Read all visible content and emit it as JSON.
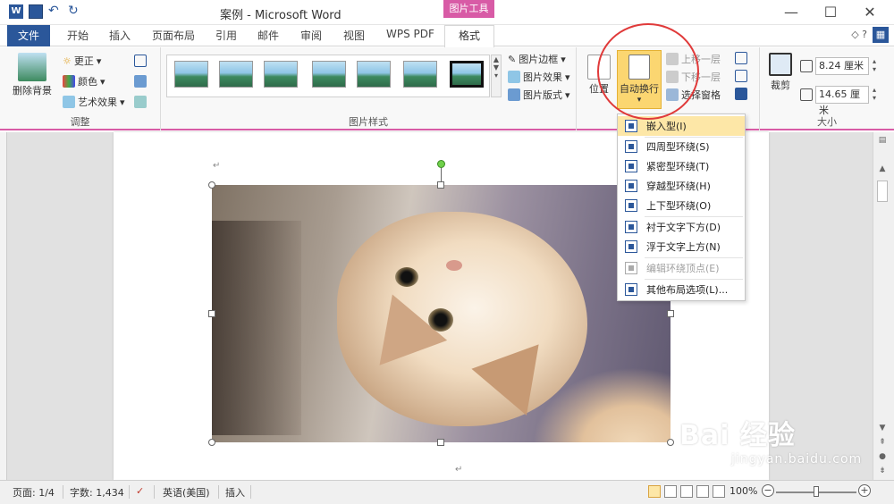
{
  "titlebar": {
    "title": "案例 - Microsoft Word",
    "tool_tab_header": "图片工具",
    "word_icon_letter": "W",
    "minimize": "—",
    "maximize": "☐",
    "close": "✕"
  },
  "tabs": {
    "file": "文件",
    "items": [
      "开始",
      "插入",
      "页面布局",
      "引用",
      "邮件",
      "审阅",
      "视图",
      "WPS PDF"
    ],
    "active": "格式",
    "help": "◇ ?"
  },
  "ribbon": {
    "adjust": {
      "label": "调整",
      "remove_bg": "删除背景",
      "corrections": "更正",
      "color": "颜色",
      "artistic": "艺术效果"
    },
    "styles": {
      "label": "图片样式",
      "border": "图片边框",
      "effects": "图片效果",
      "layout": "图片版式"
    },
    "arrange": {
      "position": "位置",
      "wrap_text": "自动换行",
      "bring_forward": "上移一层",
      "send_backward": "下移一层",
      "selection_pane": "选择窗格"
    },
    "size": {
      "label": "大小",
      "crop": "裁剪",
      "height": "8.24 厘米",
      "width": "14.65 厘米"
    }
  },
  "wrap_menu": {
    "items": [
      {
        "label": "嵌入型(I)",
        "disabled": false
      },
      {
        "label": "四周型环绕(S)",
        "disabled": false
      },
      {
        "label": "紧密型环绕(T)",
        "disabled": false
      },
      {
        "label": "穿越型环绕(H)",
        "disabled": false
      },
      {
        "label": "上下型环绕(O)",
        "disabled": false
      },
      {
        "label": "衬于文字下方(D)",
        "disabled": false
      },
      {
        "label": "浮于文字上方(N)",
        "disabled": false
      },
      {
        "label": "编辑环绕顶点(E)",
        "disabled": true
      },
      {
        "label": "其他布局选项(L)...",
        "disabled": false
      }
    ]
  },
  "document": {
    "para_mark": "↵"
  },
  "statusbar": {
    "page": "页面: 1/4",
    "words": "字数: 1,434",
    "language": "英语(美国)",
    "mode": "插入",
    "zoom": "100%",
    "zoom_minus": "−",
    "zoom_plus": "+"
  },
  "watermark": {
    "main": "Bai 经验",
    "sub": "jingyan.baidu.com"
  },
  "colors": {
    "accent": "#2b579a",
    "picture_tools": "#d85ba6",
    "highlight": "#fbd671",
    "annotation": "#e03a3a"
  }
}
